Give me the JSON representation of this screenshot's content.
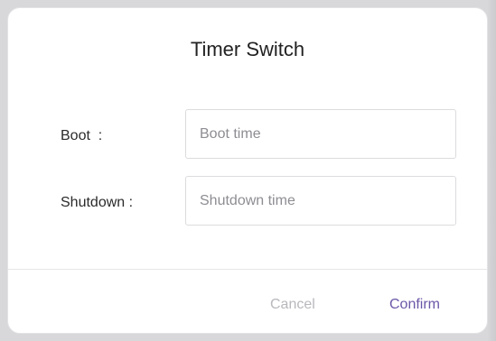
{
  "dialog": {
    "title": "Timer Switch",
    "fields": {
      "boot": {
        "label": "Boot  :",
        "placeholder": "Boot time",
        "value": ""
      },
      "shutdown": {
        "label": "Shutdown :",
        "placeholder": "Shutdown time",
        "value": ""
      }
    },
    "buttons": {
      "cancel": "Cancel",
      "confirm": "Confirm"
    }
  },
  "colors": {
    "accent": "#6b57a8",
    "disabled_text": "#b8b8bd",
    "backdrop": "#d8d8db"
  }
}
